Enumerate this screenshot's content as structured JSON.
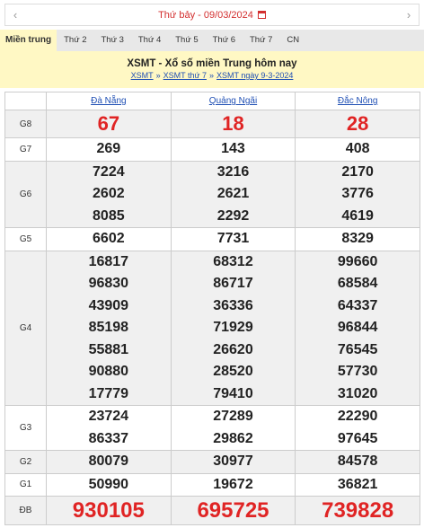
{
  "date_bar": {
    "prev": "‹",
    "date_text": "Thứ bảy -  09/03/2024",
    "next": "›",
    "icon": "calendar-icon"
  },
  "tabs": [
    "Miền trung",
    "Thứ 2",
    "Thứ 3",
    "Thứ 4",
    "Thứ 5",
    "Thứ 6",
    "Thứ 7",
    "CN"
  ],
  "header": {
    "title": "XSMT - Xổ số miền Trung hôm nay",
    "breadcrumbs": [
      "XSMT",
      "XSMT thứ 7",
      "XSMT ngày 9-3-2024"
    ],
    "separator": "»"
  },
  "provinces": [
    "Đà Nẵng",
    "Quảng Ngãi",
    "Đắc Nông"
  ],
  "prizes": [
    {
      "label": "G8",
      "values": [
        [
          "67"
        ],
        [
          "18"
        ],
        [
          "28"
        ]
      ]
    },
    {
      "label": "G7",
      "values": [
        [
          "269"
        ],
        [
          "143"
        ],
        [
          "408"
        ]
      ]
    },
    {
      "label": "G6",
      "values": [
        [
          "7224",
          "2602",
          "8085"
        ],
        [
          "3216",
          "2621",
          "2292"
        ],
        [
          "2170",
          "3776",
          "4619"
        ]
      ]
    },
    {
      "label": "G5",
      "values": [
        [
          "6602"
        ],
        [
          "7731"
        ],
        [
          "8329"
        ]
      ]
    },
    {
      "label": "G4",
      "values": [
        [
          "16817",
          "96830",
          "43909",
          "85198",
          "55881",
          "90880",
          "17779"
        ],
        [
          "68312",
          "86717",
          "36336",
          "71929",
          "26620",
          "28520",
          "79410"
        ],
        [
          "99660",
          "68584",
          "64337",
          "96844",
          "76545",
          "57730",
          "31020"
        ]
      ]
    },
    {
      "label": "G3",
      "values": [
        [
          "23724",
          "86337"
        ],
        [
          "27289",
          "29862"
        ],
        [
          "22290",
          "97645"
        ]
      ]
    },
    {
      "label": "G2",
      "values": [
        [
          "80079"
        ],
        [
          "30977"
        ],
        [
          "84578"
        ]
      ]
    },
    {
      "label": "G1",
      "values": [
        [
          "50990"
        ],
        [
          "19672"
        ],
        [
          "36821"
        ]
      ]
    },
    {
      "label": "ĐB",
      "values": [
        [
          "930105"
        ],
        [
          "695725"
        ],
        [
          "739828"
        ]
      ]
    }
  ],
  "colors": {
    "accent_red": "#e02424",
    "link_blue": "#1f4fb4",
    "header_bg": "#fff8c4"
  }
}
